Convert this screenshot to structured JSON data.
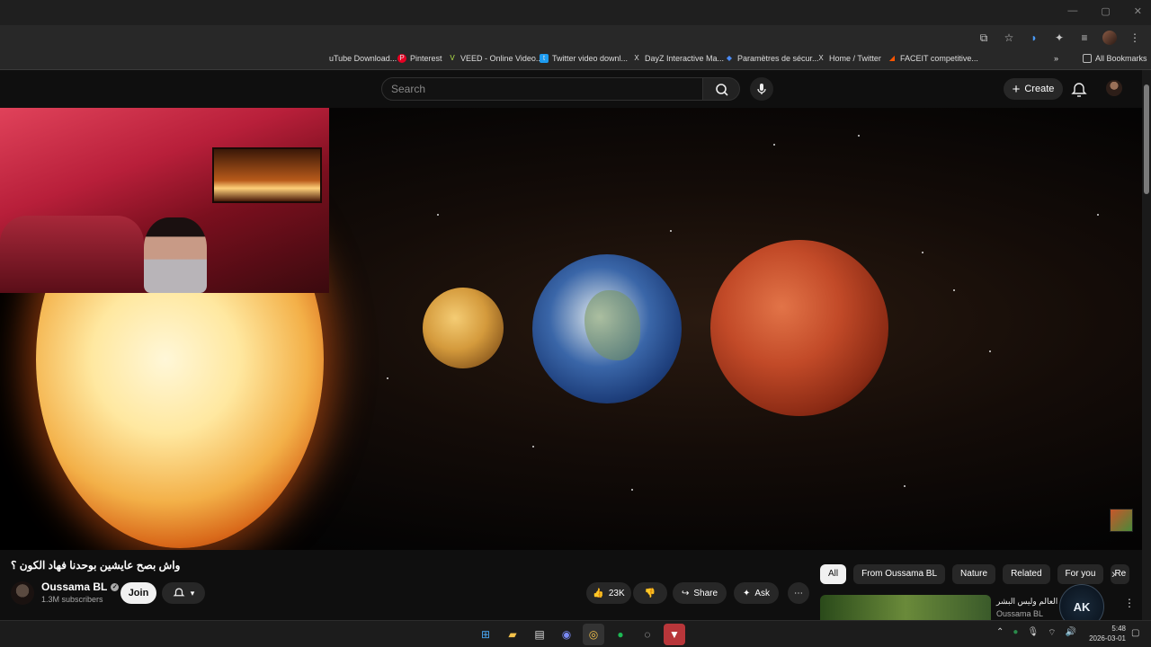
{
  "browser": {
    "bookmarks": [
      {
        "label": "uTube Download...",
        "icon": "youtube-dl-icon",
        "color": "#cc0000"
      },
      {
        "label": "Pinterest",
        "icon": "pinterest-icon",
        "color": "#e60023"
      },
      {
        "label": "VEED - Online Video...",
        "icon": "veed-icon",
        "color": "#b6e64a"
      },
      {
        "label": "Twitter video downl...",
        "icon": "twitter-dl-icon",
        "color": "#1d9bf0"
      },
      {
        "label": "DayZ Interactive Ma...",
        "icon": "dayz-icon",
        "color": "#e8e8e8"
      },
      {
        "label": "Paramètres de sécur...",
        "icon": "security-icon",
        "color": "#4a8af4"
      },
      {
        "label": "Home / Twitter",
        "icon": "x-icon",
        "color": "#ffffff"
      },
      {
        "label": "FACEIT competitive...",
        "icon": "faceit-icon",
        "color": "#ff5500"
      }
    ],
    "all_bookmarks": "All Bookmarks"
  },
  "header": {
    "search_placeholder": "Search",
    "create_label": "Create"
  },
  "video": {
    "title": "واش بصح عايشين بوحدنا فهاد الكون ؟",
    "channel": "Oussama BL",
    "subscribers": "1.3M subscribers",
    "join_label": "Join",
    "likes": "23K",
    "share_label": "Share",
    "ask_label": "Ask"
  },
  "chips": [
    "All",
    "From Oussama BL",
    "Nature",
    "Related",
    "For you",
    "Re"
  ],
  "recommendation": {
    "title": "! ... العالم وليس البشر",
    "channel": "Oussama BL"
  },
  "overlay": {
    "logo_text": "AK"
  },
  "taskbar": {
    "time": "5:48",
    "date": "2026-03-01"
  }
}
